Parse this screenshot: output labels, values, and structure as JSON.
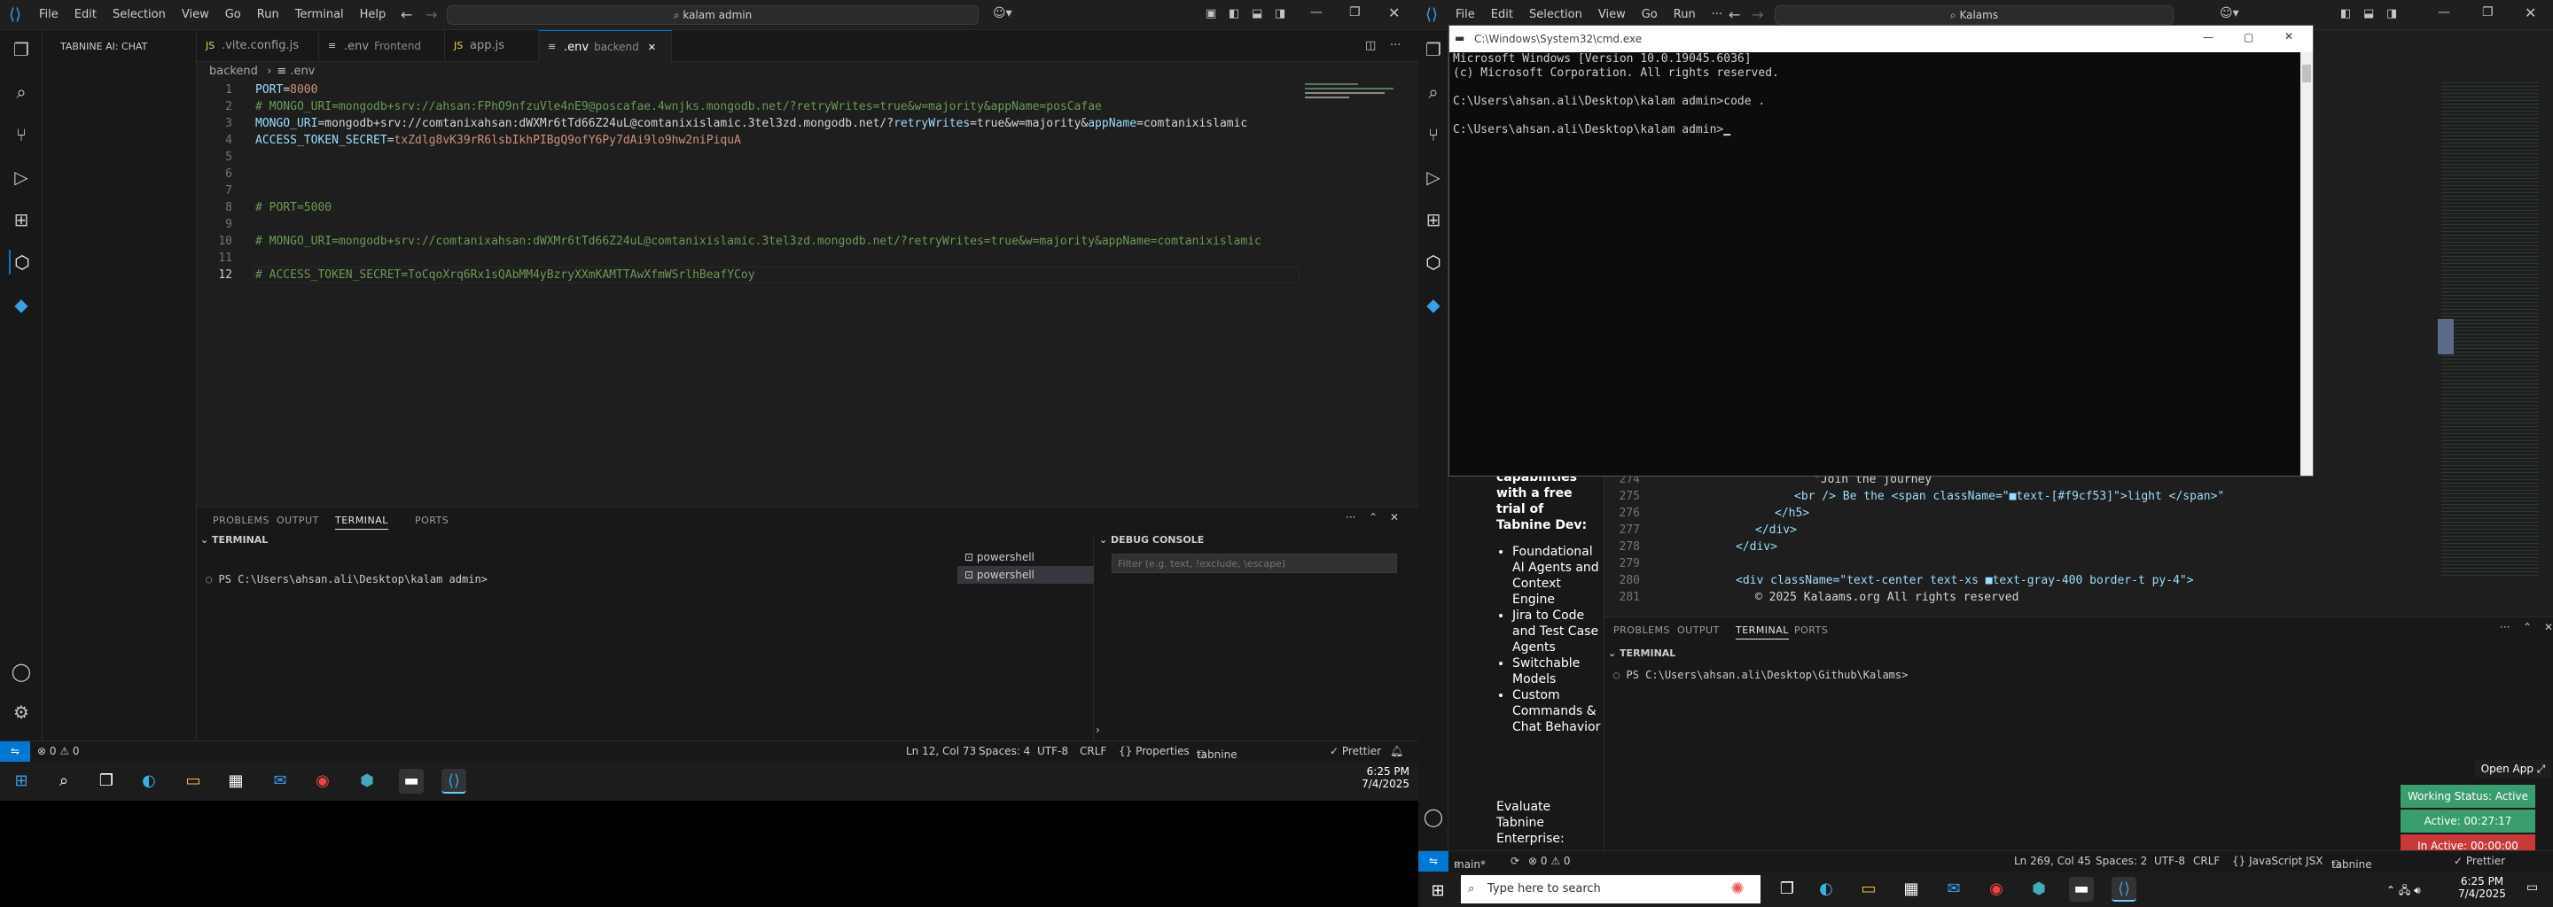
{
  "left": {
    "menu": [
      "File",
      "Edit",
      "Selection",
      "View",
      "Go",
      "Run",
      "Terminal",
      "Help"
    ],
    "search": "kalam admin",
    "sidebar_title": "TABNINE AI: CHAT",
    "tabs": [
      {
        "label": ".vite.config.js",
        "icon": "JS"
      },
      {
        "label": ".env",
        "sub": "Frontend",
        "icon": "≡"
      },
      {
        "label": "app.js",
        "icon": "JS"
      },
      {
        "label": ".env",
        "sub": "backend",
        "icon": "≡",
        "active": true
      }
    ],
    "breadcrumb": [
      "backend",
      ".env"
    ],
    "code": [
      {
        "n": "1",
        "parts": [
          [
            "k",
            "PORT"
          ],
          [
            "p",
            "="
          ],
          [
            "v",
            "8000"
          ]
        ]
      },
      {
        "n": "2",
        "parts": [
          [
            "cm",
            "# MONGO_URI=mongodb+srv://ahsan:FPhO9nfzuVle4nE9@poscafae.4wnjks.mongodb.net/?retryWrites=true&w=majority&appName=posCafae"
          ]
        ]
      },
      {
        "n": "3",
        "parts": [
          [
            "k",
            "MONGO_URI"
          ],
          [
            "p",
            "="
          ],
          [
            "p",
            "mongodb+srv://comtanixahsan:dWXMr6tTd66Z24uL@comtanixislamic.3tel3zd.mongodb.net/?"
          ],
          [
            "k",
            "retryWrites"
          ],
          [
            "p",
            "=true&w=majority&"
          ],
          [
            "k",
            "appName"
          ],
          [
            "p",
            "=comtanixislamic"
          ]
        ]
      },
      {
        "n": "4",
        "parts": [
          [
            "k",
            "ACCESS_TOKEN_SECRET"
          ],
          [
            "p",
            "="
          ],
          [
            "v",
            "txZdlg8vK39rR6lsbIkhPIBgQ9ofY6Py7dAi9lo9hw2niPiquA"
          ]
        ]
      },
      {
        "n": "5",
        "parts": []
      },
      {
        "n": "6",
        "parts": []
      },
      {
        "n": "7",
        "parts": []
      },
      {
        "n": "8",
        "parts": [
          [
            "cm",
            "# PORT=5000"
          ]
        ]
      },
      {
        "n": "9",
        "parts": []
      },
      {
        "n": "10",
        "parts": [
          [
            "cm",
            "# MONGO_URI=mongodb+srv://comtanixahsan:dWXMr6tTd66Z24uL@comtanixislamic.3tel3zd.mongodb.net/?retryWrites=true&w=majority&appName=comtanixislamic"
          ]
        ]
      },
      {
        "n": "11",
        "parts": []
      },
      {
        "n": "12",
        "parts": [
          [
            "cm",
            "# ACCESS_TOKEN_SECRET=ToCqoXrq6Rx1sQAbMM4yBzryXXmKAMTTAwXfmWSrlhBeafYCoy"
          ]
        ]
      }
    ],
    "panel_tabs": [
      "PROBLEMS",
      "OUTPUT",
      "TERMINAL",
      "PORTS"
    ],
    "terminal_header": "TERMINAL",
    "terminal_line": "PS C:\\Users\\ahsan.ali\\Desktop\\kalam admin>",
    "shells": [
      "powershell",
      "powershell"
    ],
    "debug_header": "DEBUG CONSOLE",
    "debug_placeholder": "Filter (e.g. text, !exclude, \\escape)",
    "status": {
      "errors": "⊗ 0 ⚠ 0",
      "position": "Ln 12, Col 73",
      "spaces": "Spaces: 4",
      "encoding": "UTF-8",
      "eol": "CRLF",
      "lang": "{} Properties",
      "tabnine": "tabnine basic",
      "prettier": "✓ Prettier"
    },
    "clock": {
      "time": "6:25 PM",
      "date": "7/4/2025"
    }
  },
  "cmd": {
    "title": "C:\\Windows\\System32\\cmd.exe",
    "lines": [
      "Microsoft Windows [Version 10.0.19045.6036]",
      "(c) Microsoft Corporation. All rights reserved.",
      "",
      "C:\\Users\\ahsan.ali\\Desktop\\kalam admin>code .",
      "",
      "C:\\Users\\ahsan.ali\\Desktop\\kalam admin>"
    ]
  },
  "right": {
    "menu": [
      "File",
      "Edit",
      "Selection",
      "View",
      "Go",
      "Run",
      "···"
    ],
    "search": "Kalams",
    "chat_heading": [
      "capabilities",
      "with a free",
      "trial of",
      "Tabnine Dev:"
    ],
    "chat_bullets": [
      "Foundational AI Agents and Context Engine",
      "Jira to Code and Test Case Agents",
      "Switchable Models",
      "Custom Commands & Chat Behavior"
    ],
    "chat_footer": [
      "Evaluate",
      "Tabnine",
      "Enterprise:"
    ],
    "code": [
      {
        "n": "274",
        "text": "\"Join the journey"
      },
      {
        "n": "275",
        "text": "<br /> Be the <span className=\"■text-[#f9cf53]\">light </span>\""
      },
      {
        "n": "276",
        "text": "</h5>"
      },
      {
        "n": "277",
        "text": "</div>"
      },
      {
        "n": "278",
        "text": "</div>"
      },
      {
        "n": "279",
        "text": ""
      },
      {
        "n": "280",
        "text": "<div className=\"text-center text-xs ■text-gray-400 border-t py-4\">"
      },
      {
        "n": "281",
        "text": "© 2025 Kalaams.org All rights reserved"
      }
    ],
    "panel_tabs": [
      "PROBLEMS",
      "OUTPUT",
      "TERMINAL",
      "PORTS"
    ],
    "terminal_header": "TERMINAL",
    "terminal_line": "PS C:\\Users\\ahsan.ali\\Desktop\\Github\\Kalams>",
    "open_app": "Open App ⤢",
    "working": "Working Status: Active",
    "active": "Active: 00:27:17",
    "inactive": "In Active: 00:00:00",
    "status": {
      "branch": "main*",
      "errors": "⊗ 0 ⚠ 0",
      "position": "Ln 269, Col 45",
      "spaces": "Spaces: 2",
      "encoding": "UTF-8",
      "eol": "CRLF",
      "lang": "{} JavaScript JSX",
      "tabnine": "tabnine basic",
      "prettier": "✓ Prettier"
    },
    "search_taskbar": "Type here to search",
    "clock": {
      "time": "6:25 PM",
      "date": "7/4/2025"
    }
  }
}
